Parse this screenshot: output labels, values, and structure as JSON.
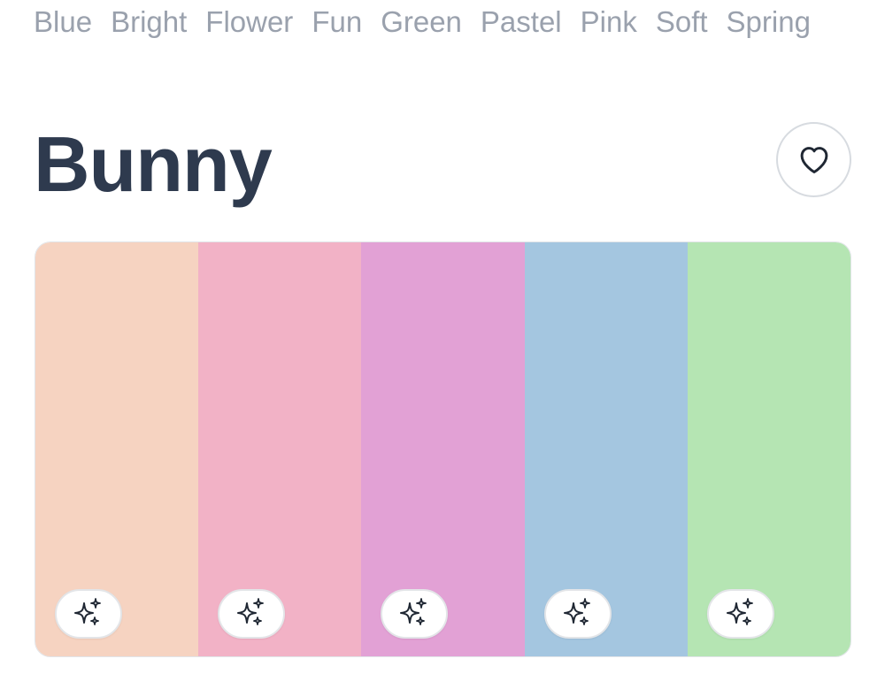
{
  "tags": [
    "Blue",
    "Bright",
    "Flower",
    "Fun",
    "Green",
    "Pastel",
    "Pink",
    "Soft",
    "Spring"
  ],
  "title": "Bunny",
  "palette": {
    "colors": [
      "#F6D3C1",
      "#F2B2C6",
      "#E2A1D5",
      "#A4C6E0",
      "#B5E5B3"
    ]
  },
  "icons": {
    "favorite": "heart-icon",
    "magic": "sparkles-icon"
  }
}
